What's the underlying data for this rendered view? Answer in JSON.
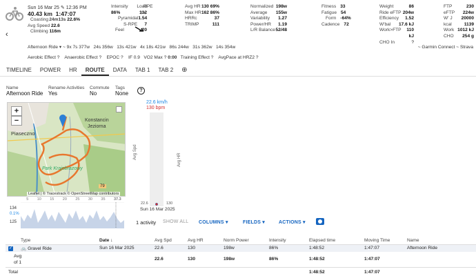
{
  "header": {
    "date": "Sun 16 Mar 25",
    "time": "12:36 PM",
    "distance": "40.43 km",
    "duration": "1:47:07",
    "coasting_label": "Coasting",
    "coasting_value": "24m13s",
    "coasting_pct": "22.6%",
    "avg_speed_label": "Avg Speed",
    "avg_speed_value": "22.6",
    "climbing_label": "Climbing",
    "climbing_value": "116m"
  },
  "stats_cols": [
    [
      {
        "label": "Intensity",
        "value": "Load"
      },
      {
        "label": "86%",
        "value": "132"
      },
      {
        "label": "Pyramidal",
        "value": "1.54"
      },
      {
        "label": "S-RPE",
        "value": "7"
      },
      {
        "label": "Feel",
        "value": "20"
      }
    ],
    [
      {
        "label": "RPE",
        "value": ""
      }
    ],
    [
      {
        "label": "Avg HR",
        "value": "130 69%"
      },
      {
        "label": "Max HR",
        "value": "162 86%"
      },
      {
        "label": "HRRc",
        "value": "37"
      },
      {
        "label": "TRIMP",
        "value": "111"
      }
    ],
    [
      {
        "label": "Normalized",
        "value": "198w"
      },
      {
        "label": "Average",
        "value": "155w"
      },
      {
        "label": "Variability",
        "value": "1.27"
      },
      {
        "label": "Power/HR",
        "value": "1.19"
      },
      {
        "label": "L/R Balance",
        "value": "52/48"
      }
    ],
    [
      {
        "label": "Fitness",
        "value": "33"
      },
      {
        "label": "Fatigue",
        "value": "54"
      },
      {
        "label": "Form",
        "value": "-64%"
      },
      {
        "label": "Cadence",
        "value": "72"
      }
    ],
    [
      {
        "label": "Weight",
        "value": "86"
      },
      {
        "label": "Ride eFTP",
        "value": "204w"
      },
      {
        "label": "Efficiency",
        "value": "1.52"
      },
      {
        "label": "W'bal",
        "value": "17.6 kJ"
      },
      {
        "label": "Work>FTP",
        "value": "110 kJ"
      },
      {
        "label": "CHO In",
        "value": ""
      }
    ],
    [
      {
        "label": "FTP",
        "value": "230"
      },
      {
        "label": "eFTP",
        "value": "224w"
      },
      {
        "label": "W' J",
        "value": "20000"
      },
      {
        "label": "kcal",
        "value": "1139"
      },
      {
        "label": "Work",
        "value": "1012 kJ"
      },
      {
        "label": "CHO",
        "value": "254 g"
      }
    ]
  ],
  "intervals_line": "Afternoon Ride",
  "intervals": [
    "9x 7s 377w",
    "24s 356w",
    "13s 421w",
    "4x 18s 421w",
    "86s 244w",
    "31s 362w",
    "14s 354w"
  ],
  "source": "~ Garmin Connect ~ Strava",
  "effects": [
    "Aerobic Effect",
    "Anaerobic Effect",
    "EPOC",
    "IF 0.9",
    "VO2 Max",
    "0:00",
    "Training Effect",
    "AvgPace at HRZ2"
  ],
  "tabs": [
    "TIMELINE",
    "POWER",
    "HR",
    "ROUTE",
    "DATA",
    "TAB 1",
    "TAB 2"
  ],
  "activity_info": {
    "name_label": "Name",
    "name_value": "Afternoon Ride",
    "rename_label": "Rename Activities",
    "rename_value": "Yes",
    "commute_label": "Commute",
    "commute_value": "No",
    "tags_label": "Tags",
    "tags_value": "None"
  },
  "map": {
    "towns": [
      "Piaseczno",
      "Konstancin",
      "Jeziorna",
      "Park Krajobrazowy"
    ],
    "attribution": "Leaflet | © Tracestrack © OpenStreetMap contributors",
    "marker_79": "79"
  },
  "profile": {
    "y_top": "134",
    "y_top_pct": "0.1%",
    "y_bottom_pct": "125",
    "x_ticks": [
      "5",
      "10",
      "15",
      "20",
      "25",
      "30",
      "35",
      "37.3"
    ]
  },
  "mini_chart": {
    "speed": "22.6 km/h",
    "hr": "130 bpm",
    "avg_spd_axis": "Avg Spd",
    "avg_hr_axis": "Avg HR",
    "left_val": "22.6",
    "right_val": "130",
    "date": "Sun 16 Mar 2025"
  },
  "chart_data": {
    "type": "bar",
    "categories": [
      "Sun 16 Mar 2025"
    ],
    "series": [
      {
        "name": "Avg Spd",
        "values": [
          22.6
        ]
      },
      {
        "name": "Avg HR",
        "values": [
          130
        ]
      }
    ],
    "xlabel": "",
    "ylabel": ""
  },
  "toolbar": {
    "count": "1 activity",
    "show_all": "SHOW ALL",
    "columns": "COLUMNS",
    "fields": "FIELDS",
    "actions": "ACTIONS"
  },
  "table": {
    "headers": [
      "Type",
      "Date",
      "Avg Spd",
      "Avg HR",
      "Norm Power",
      "Intensity",
      "Elapsed time",
      "Moving Time",
      "Name"
    ],
    "row": [
      "Gravel Ride",
      "Sun 16 Mar 2025",
      "22.6",
      "130",
      "198w",
      "86%",
      "1:48:52",
      "1:47:07",
      "Afternoon Ride"
    ],
    "avg_label_1": "Avg",
    "avg_label_2": "of 1",
    "avg_row": [
      "22.6",
      "130",
      "198w",
      "86%",
      "1:48:52",
      "1:47:07"
    ],
    "total_label": "Total",
    "total_row": [
      "1:48:52",
      "1:47:07"
    ]
  },
  "colors": {
    "accent": "#1565c0",
    "route": "#e8772e",
    "speed": "#1e88e5",
    "hr": "#d32f2f"
  }
}
